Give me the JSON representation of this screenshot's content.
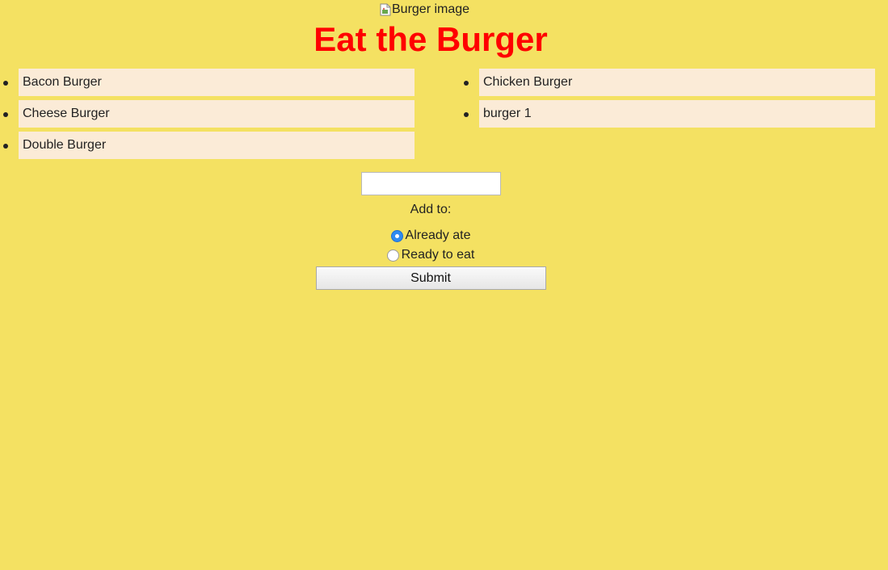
{
  "header": {
    "image_alt": "Burger image",
    "title": "Eat the Burger"
  },
  "lists": {
    "left": [
      {
        "label": "Bacon Burger"
      },
      {
        "label": "Cheese Burger"
      },
      {
        "label": "Double Burger"
      }
    ],
    "right": [
      {
        "label": "Chicken Burger"
      },
      {
        "label": "burger 1"
      }
    ]
  },
  "form": {
    "burger_name_value": "",
    "add_to_label": "Add to:",
    "options": [
      {
        "label": "Already ate",
        "checked": true
      },
      {
        "label": "Ready to eat",
        "checked": false
      }
    ],
    "submit_label": "Submit"
  },
  "colors": {
    "background": "#f4e162",
    "title": "#ff0000",
    "list_item_bg": "#fbebd7",
    "radio_checked": "#2f8bf0"
  }
}
